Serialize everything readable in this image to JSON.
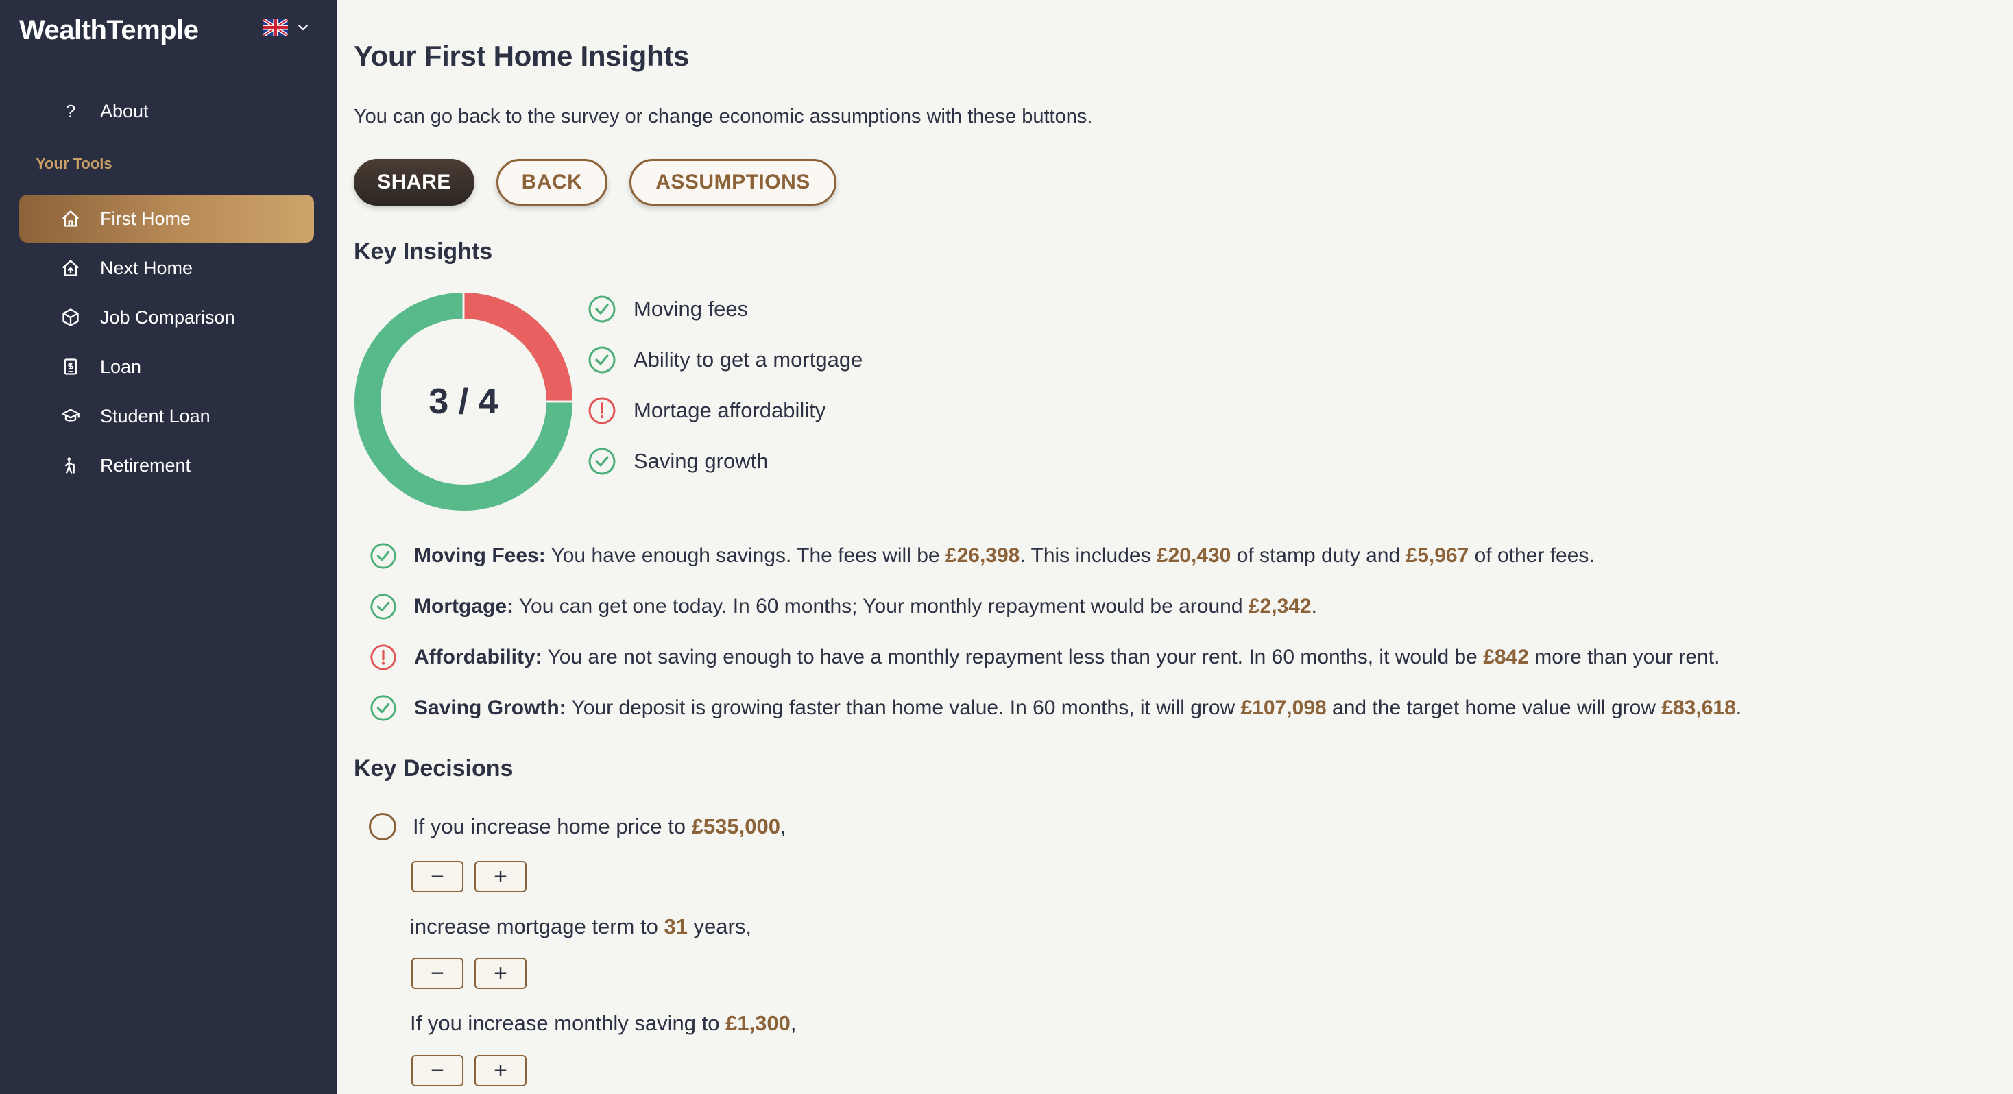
{
  "sidebar": {
    "brand": "WealthTemple",
    "about": "About",
    "section_label": "Your Tools",
    "items": [
      {
        "label": "First Home",
        "icon": "home-icon"
      },
      {
        "label": "Next Home",
        "icon": "home-up-icon"
      },
      {
        "label": "Job Comparison",
        "icon": "cube-icon"
      },
      {
        "label": "Loan",
        "icon": "loan-document-icon"
      },
      {
        "label": "Student Loan",
        "icon": "graduation-cap-icon"
      },
      {
        "label": "Retirement",
        "icon": "walking-cane-icon"
      }
    ],
    "language_flag": "uk-flag-icon"
  },
  "main": {
    "title": "Your First Home Insights",
    "subtitle": "You can go back to the survey or change economic assumptions with these buttons.",
    "buttons": {
      "share": "SHARE",
      "back": "BACK",
      "assumptions": "ASSUMPTIONS"
    },
    "key_insights_title": "Key Insights",
    "score": "3 / 4",
    "score_fraction": 0.75,
    "legend": [
      {
        "label": "Moving fees",
        "status": "ok"
      },
      {
        "label": "Ability to get a mortgage",
        "status": "ok"
      },
      {
        "label": "Mortage affordability",
        "status": "warn"
      },
      {
        "label": "Saving growth",
        "status": "ok"
      }
    ],
    "insights": [
      {
        "status": "ok",
        "title": "Moving Fees:",
        "t1": " You have enough savings. The fees will be ",
        "v1": "£26,398",
        "t2": ". This includes ",
        "v2": "£20,430",
        "t3": " of stamp duty and ",
        "v3": "£5,967",
        "t4": " of other fees."
      },
      {
        "status": "ok",
        "title": "Mortgage:",
        "t1": " You can get one today. In 60 months; Your monthly repayment would be around ",
        "v1": "£2,342",
        "t2": "."
      },
      {
        "status": "warn",
        "title": "Affordability:",
        "t1": " You are not saving enough to have a monthly repayment less than your rent. In 60 months, it would be ",
        "v1": "£842",
        "t2": " more than your rent."
      },
      {
        "status": "ok",
        "title": "Saving Growth:",
        "t1": " Your deposit is growing faster than home value. In 60 months, it will grow ",
        "v1": "£107,098",
        "t2": " and the target home value will grow ",
        "v2": "£83,618",
        "t3": "."
      }
    ],
    "key_decisions_title": "Key Decisions",
    "decisions": {
      "d1_pre": "If you increase home price to ",
      "d1_val": "£535,000",
      "d1_post": ",",
      "d2_pre": "increase mortgage term to ",
      "d2_val": "31",
      "d2_post": " years,",
      "d3_pre": "If you increase monthly saving to ",
      "d3_val": "£1,300",
      "d3_post": ",",
      "minus": "−",
      "plus": "+"
    }
  },
  "colors": {
    "accent": "#8c6239",
    "ok": "#4caf7a",
    "warn": "#e25555",
    "sidebar": "#2a2e41"
  }
}
